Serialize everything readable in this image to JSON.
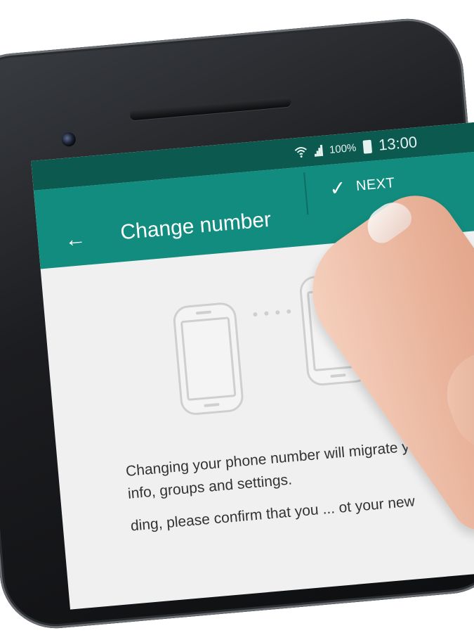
{
  "status_bar": {
    "battery_percent": "100%",
    "time": "13:00",
    "icons": [
      "wifi-icon",
      "signal-icon",
      "battery-icon"
    ]
  },
  "app_bar": {
    "title": "Change number",
    "back_icon": "back-arrow-icon",
    "next_label": "NEXT",
    "next_icon": "check-icon"
  },
  "content": {
    "illustration": [
      "old-phone-icon",
      "transfer-dots",
      "new-phone-icon"
    ],
    "paragraph1": "Changing your phone number will migrate your account info, groups and settings.",
    "paragraph2": "ding, please confirm that you ... ot your new"
  },
  "colors": {
    "status_bar": "#0c5a4f",
    "app_bar": "#128c7e",
    "background": "#f0f0f0"
  }
}
